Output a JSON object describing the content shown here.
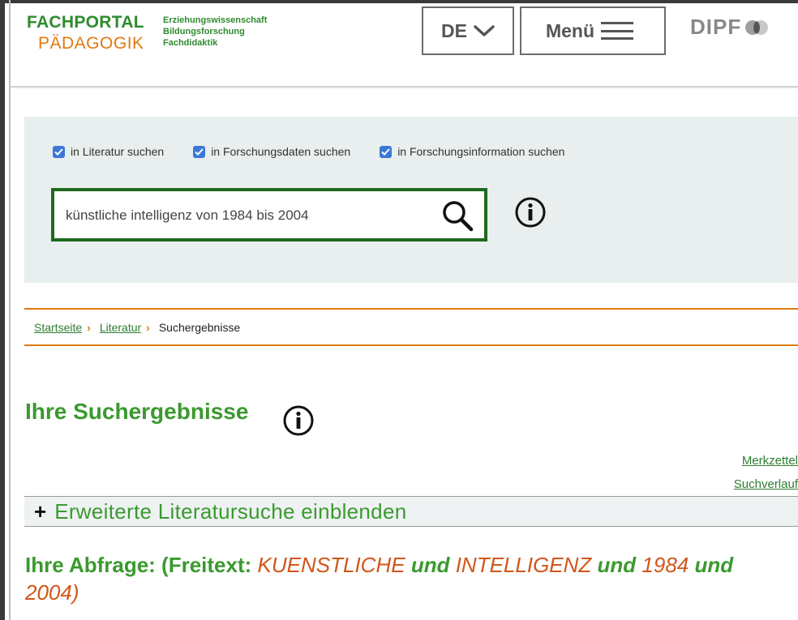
{
  "header": {
    "logo_line1": "FACHPORTAL",
    "logo_line2": "PÄDAGOGIK",
    "logo_sub1": "Erziehungswissenschaft",
    "logo_sub2": "Bildungsforschung",
    "logo_sub3": "Fachdidaktik",
    "language_label": "DE",
    "menu_label": "Menü",
    "partner_label": "DIPF"
  },
  "search": {
    "checkboxes": [
      {
        "label": "in Literatur suchen",
        "checked": true
      },
      {
        "label": "in Forschungsdaten suchen",
        "checked": true
      },
      {
        "label": "in Forschungsinformation suchen",
        "checked": true
      }
    ],
    "query_value": "künstliche intelligenz von 1984 bis 2004",
    "search_icon": "search-icon",
    "info_icon": "info-icon"
  },
  "breadcrumb": {
    "items": [
      "Startseite",
      "Literatur"
    ],
    "current": "Suchergebnisse"
  },
  "results": {
    "title": "Ihre Suchergebnisse",
    "merkzettel_link": "Merkzettel",
    "suchverlauf_link": "Suchverlauf",
    "advanced_toggle": "Erweiterte Literatursuche einblenden",
    "query_prefix": "Ihre Abfrage: (Freitext:",
    "query_term1": "KUENSTLICHE",
    "query_op1": "und",
    "query_term2": "INTELLIGENZ",
    "query_op2": "und",
    "query_term3": "1984",
    "query_op3": "und",
    "query_term4": "2004",
    "query_suffix": ")"
  },
  "colors": {
    "brand_green": "#3a9a2e",
    "dark_green": "#1e6a1e",
    "brand_orange": "#e07a10",
    "term_orange": "#d2561a",
    "panel_bg": "#e9eeee",
    "checkbox_blue": "#3b78d8"
  }
}
